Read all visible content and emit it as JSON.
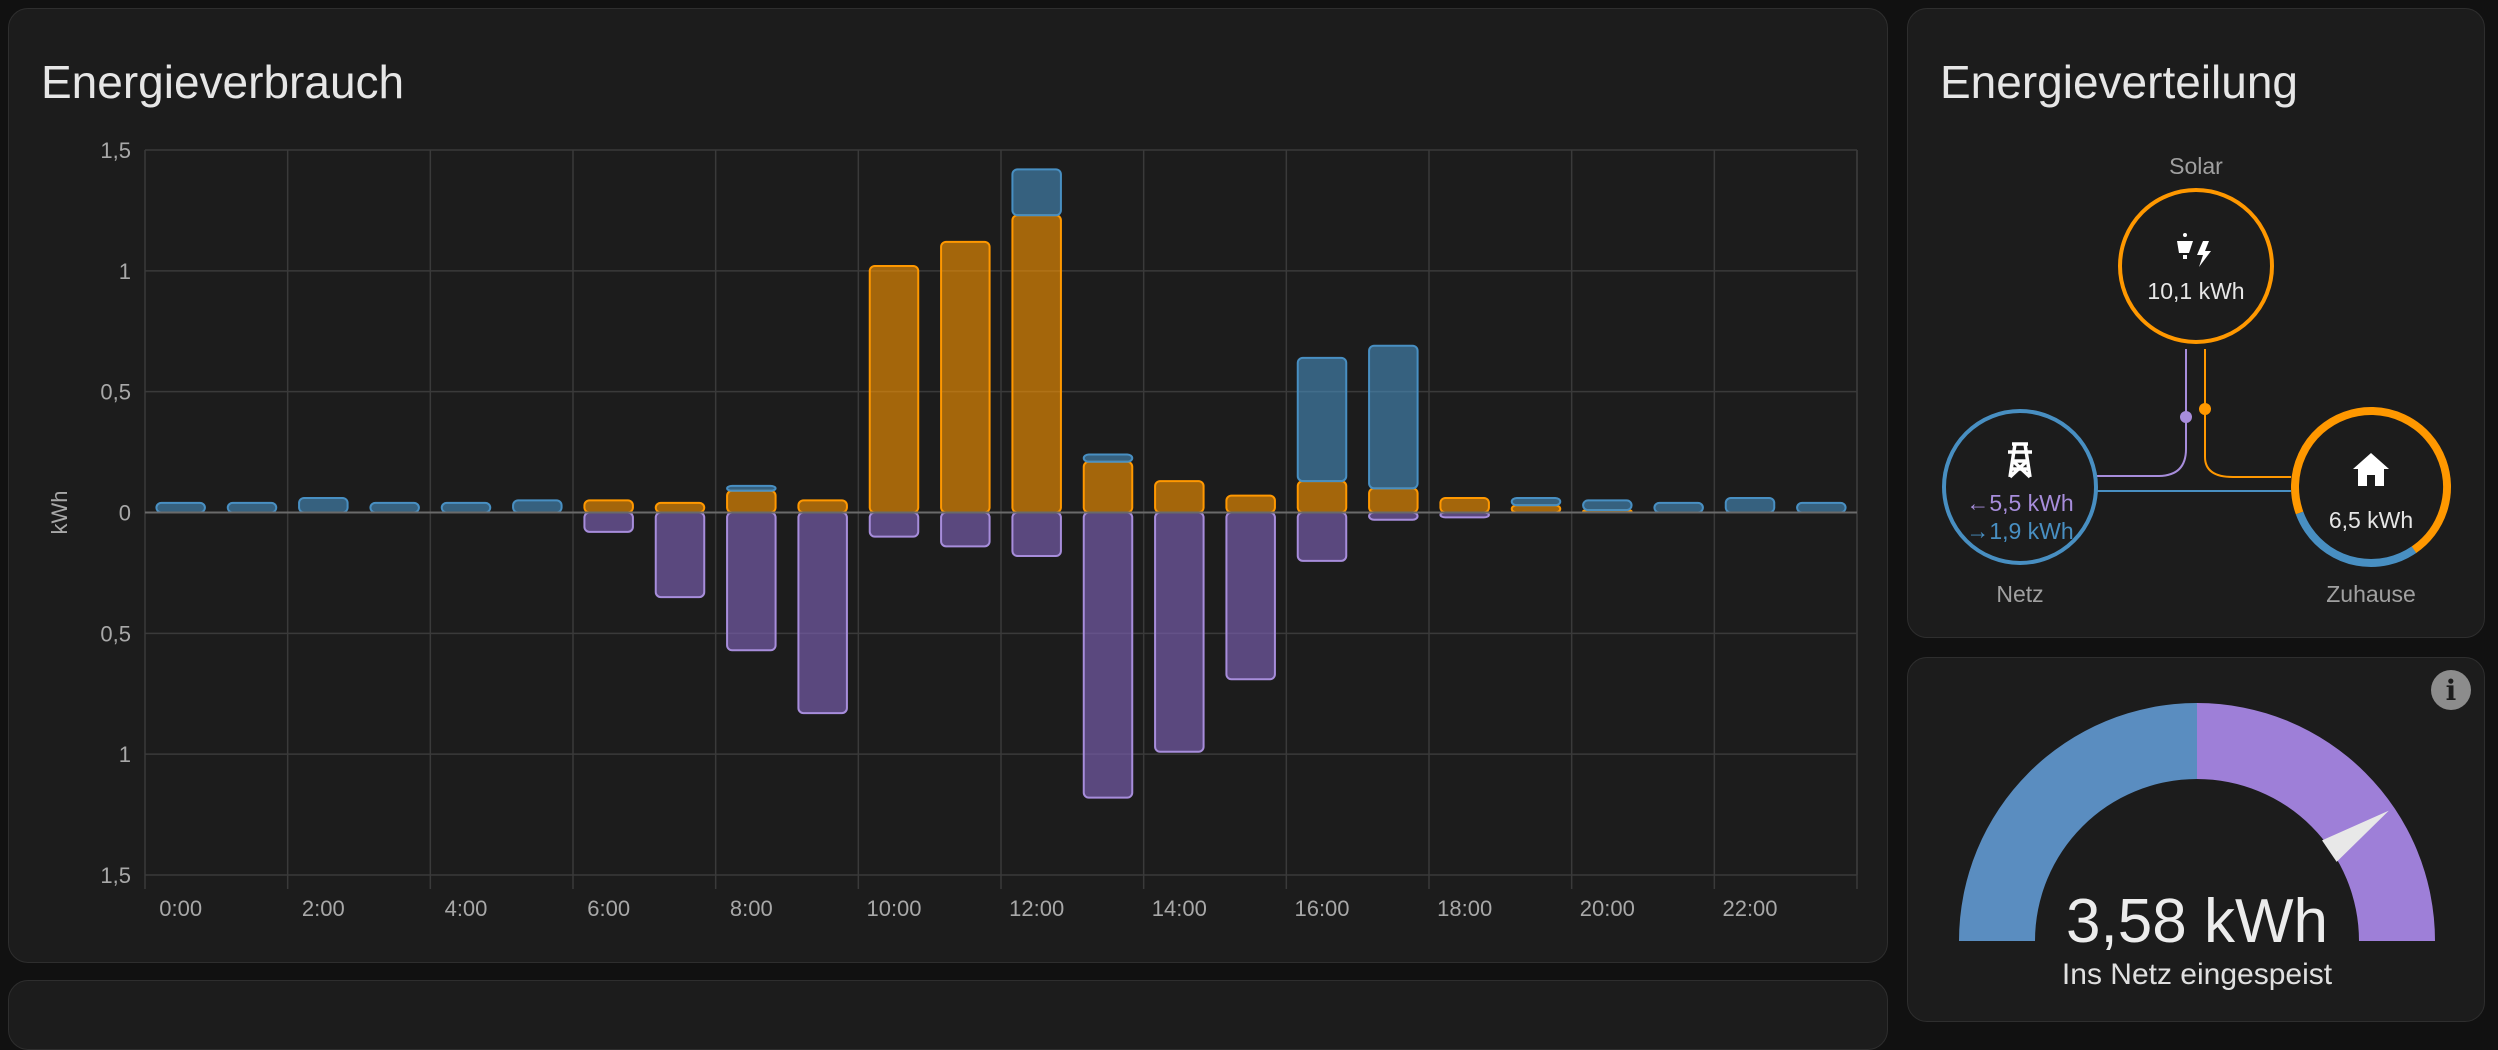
{
  "energy_usage": {
    "title": "Energieverbrauch",
    "chart_data": {
      "type": "bar",
      "stacked": true,
      "ylabel": "kWh",
      "ylim": [
        -1.5,
        1.5
      ],
      "y_tick_labels": [
        "1,5",
        "1",
        "0,5",
        "0",
        "0,5",
        "1",
        "1,5"
      ],
      "x_tick_labels": [
        "0:00",
        "2:00",
        "4:00",
        "6:00",
        "8:00",
        "10:00",
        "12:00",
        "14:00",
        "16:00",
        "18:00",
        "20:00",
        "22:00"
      ],
      "grid": true,
      "hours": [
        0,
        1,
        2,
        3,
        4,
        5,
        6,
        7,
        8,
        9,
        10,
        11,
        12,
        13,
        14,
        15,
        16,
        17,
        18,
        19,
        20,
        21,
        22,
        23
      ],
      "series": [
        {
          "key": "solar_consumed",
          "color": "#ff9800",
          "values": [
            0,
            0,
            0,
            0,
            0,
            0,
            0.05,
            0.04,
            0.09,
            0.05,
            1.02,
            1.12,
            1.23,
            0.21,
            0.13,
            0.07,
            0.13,
            0.1,
            0.06,
            0.03,
            0.01,
            0,
            0,
            0
          ]
        },
        {
          "key": "grid_consumed",
          "color": "#488fc2",
          "values": [
            0.04,
            0.04,
            0.06,
            0.04,
            0.04,
            0.05,
            0,
            0,
            0.02,
            0,
            0,
            0,
            0.19,
            0.03,
            0,
            0,
            0.51,
            0.59,
            0,
            0.03,
            0.04,
            0.04,
            0.06,
            0.04
          ]
        },
        {
          "key": "returned_to_grid",
          "color": "#8353d4",
          "values": [
            0,
            0,
            0,
            0,
            0,
            0,
            -0.08,
            -0.35,
            -0.57,
            -0.83,
            -0.1,
            -0.14,
            -0.18,
            -1.18,
            -0.99,
            -0.69,
            -0.2,
            -0.03,
            -0.02,
            0,
            0,
            0,
            0,
            0
          ]
        }
      ]
    }
  },
  "energy_distribution": {
    "title": "Energieverteilung",
    "solar": {
      "label": "Solar",
      "value": "10,1 kWh",
      "color": "#ff9800",
      "icon": "solar-power-icon"
    },
    "grid": {
      "label": "Netz",
      "import_value": "5,5 kWh",
      "export_value": "1,9 kWh",
      "color": "#488fc2",
      "return_color": "#a78ddb",
      "icon": "transmission-tower-icon"
    },
    "home": {
      "label": "Zuhause",
      "value": "6,5 kWh",
      "icon": "home-icon",
      "solar_share": 0.71,
      "grid_share": 0.29
    },
    "import_arrow": "←",
    "export_arrow": "→"
  },
  "gauge": {
    "value": "3,58 kWh",
    "label": "Ins Netz eingespeist",
    "fraction": 0.81,
    "colors": {
      "left": "#5a8dc0",
      "right": "#9e7fd8"
    },
    "info_icon": "info-icon"
  }
}
